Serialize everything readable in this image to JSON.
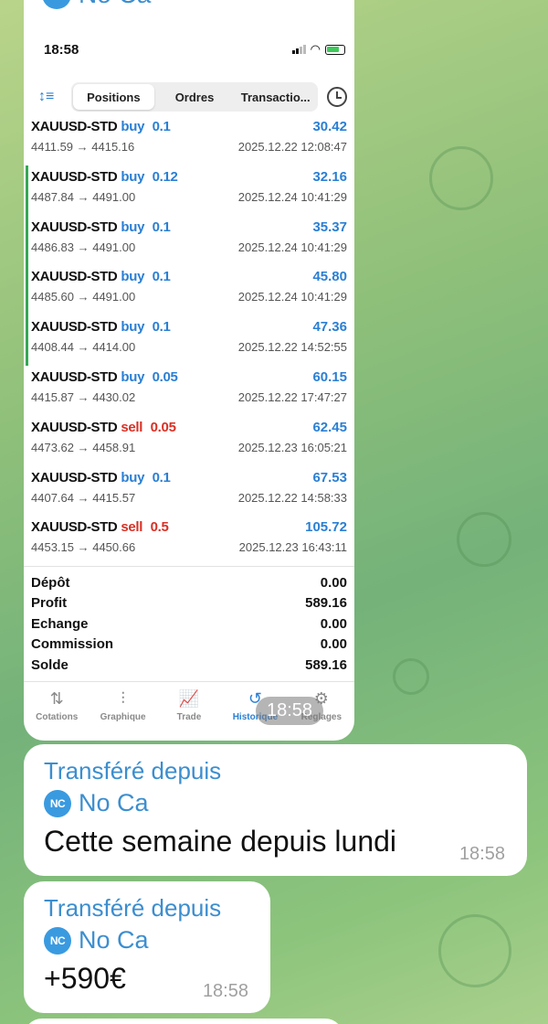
{
  "forward_header": {
    "badge": "NC",
    "name": "No Ca"
  },
  "phone": {
    "status_time": "18:58",
    "tabs": [
      "Positions",
      "Ordres",
      "Transactio..."
    ],
    "trades": [
      {
        "symbol": "XAUUSD-STD",
        "side": "buy",
        "volume": "0.1",
        "side_color": "#2a7fd4",
        "prices": "4411.59 → 4415.16",
        "date": "2025.12.22 12:08:47",
        "profit": "30.42",
        "marked": false
      },
      {
        "symbol": "XAUUSD-STD",
        "side": "buy",
        "volume": "0.12",
        "side_color": "#2a7fd4",
        "prices": "4487.84 → 4491.00",
        "date": "2025.12.24 10:41:29",
        "profit": "32.16",
        "marked": true
      },
      {
        "symbol": "XAUUSD-STD",
        "side": "buy",
        "volume": "0.1",
        "side_color": "#2a7fd4",
        "prices": "4486.83 → 4491.00",
        "date": "2025.12.24 10:41:29",
        "profit": "35.37",
        "marked": true
      },
      {
        "symbol": "XAUUSD-STD",
        "side": "buy",
        "volume": "0.1",
        "side_color": "#2a7fd4",
        "prices": "4485.60 → 4491.00",
        "date": "2025.12.24 10:41:29",
        "profit": "45.80",
        "marked": true
      },
      {
        "symbol": "XAUUSD-STD",
        "side": "buy",
        "volume": "0.1",
        "side_color": "#2a7fd4",
        "prices": "4408.44 → 4414.00",
        "date": "2025.12.22 14:52:55",
        "profit": "47.36",
        "marked": true
      },
      {
        "symbol": "XAUUSD-STD",
        "side": "buy",
        "volume": "0.05",
        "side_color": "#2a7fd4",
        "prices": "4415.87 → 4430.02",
        "date": "2025.12.22 17:47:27",
        "profit": "60.15",
        "marked": false
      },
      {
        "symbol": "XAUUSD-STD",
        "side": "sell",
        "volume": "0.05",
        "side_color": "#d93025",
        "prices": "4473.62 → 4458.91",
        "date": "2025.12.23 16:05:21",
        "profit": "62.45",
        "marked": false
      },
      {
        "symbol": "XAUUSD-STD",
        "side": "buy",
        "volume": "0.1",
        "side_color": "#2a7fd4",
        "prices": "4407.64 → 4415.57",
        "date": "2025.12.22 14:58:33",
        "profit": "67.53",
        "marked": false
      },
      {
        "symbol": "XAUUSD-STD",
        "side": "sell",
        "volume": "0.5",
        "side_color": "#d93025",
        "prices": "4453.15 → 4450.66",
        "date": "2025.12.23 16:43:11",
        "profit": "105.72",
        "marked": false
      }
    ],
    "summary": [
      {
        "label": "Dépôt",
        "value": "0.00"
      },
      {
        "label": "Profit",
        "value": "589.16"
      },
      {
        "label": "Echange",
        "value": "0.00"
      },
      {
        "label": "Commission",
        "value": "0.00"
      },
      {
        "label": "Solde",
        "value": "589.16"
      }
    ],
    "nav": [
      {
        "label": "Cotations",
        "icon": "sort-arrows-icon",
        "glyph": "⇅",
        "active": false
      },
      {
        "label": "Graphique",
        "icon": "candles-icon",
        "glyph": "⫶",
        "active": false
      },
      {
        "label": "Trade",
        "icon": "chart-icon",
        "glyph": "📈",
        "active": false
      },
      {
        "label": "Historique",
        "icon": "history-icon",
        "glyph": "↺",
        "active": true
      },
      {
        "label": "Réglages",
        "icon": "gear-icon",
        "glyph": "⚙",
        "active": false
      }
    ]
  },
  "screenshot_time": "18:58",
  "messages": [
    {
      "forwarded_label": "Transféré depuis",
      "badge": "NC",
      "from": "No Ca",
      "text": "Cette semaine depuis lundi",
      "time": "18:58"
    },
    {
      "forwarded_label": "Transféré depuis",
      "badge": "NC",
      "from": "No Ca",
      "text": "+590€",
      "time": "18:58"
    }
  ]
}
